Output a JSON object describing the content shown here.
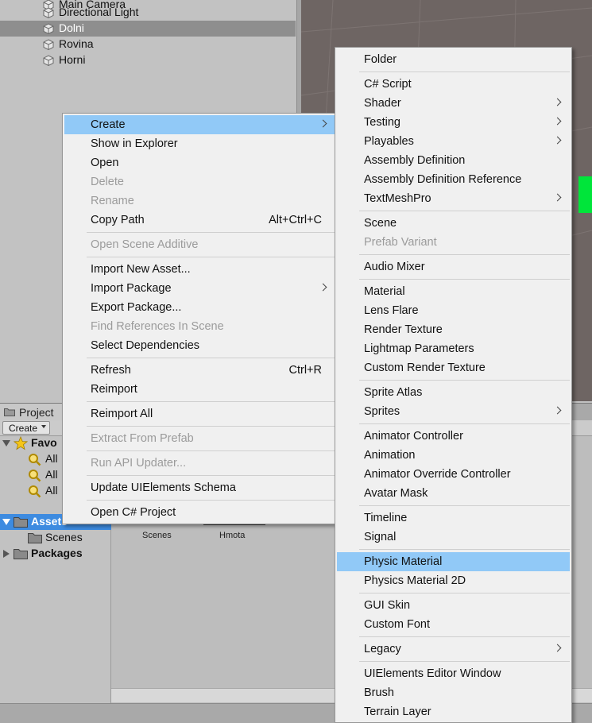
{
  "hierarchy": {
    "items": [
      {
        "label": "Main Camera",
        "selected": false
      },
      {
        "label": "Directional Light",
        "selected": false
      },
      {
        "label": "Dolni",
        "selected": true
      },
      {
        "label": "Rovina",
        "selected": false
      },
      {
        "label": "Horni",
        "selected": false
      }
    ]
  },
  "project": {
    "tab_label": "Project",
    "create_label": "Create",
    "favorites_label": "Favo",
    "favorites_items": [
      "All",
      "All",
      "All"
    ],
    "assets_label": "Assets",
    "scenes_label": "Scenes",
    "packages_label": "Packages",
    "grid_items": [
      "Scenes",
      "Hmota"
    ]
  },
  "context_menu": {
    "items": [
      {
        "label": "Create",
        "shortcut": "",
        "disabled": false,
        "highlighted": true,
        "submenu": true
      },
      {
        "label": "Show in Explorer",
        "shortcut": "",
        "disabled": false,
        "highlighted": false,
        "submenu": false
      },
      {
        "label": "Open",
        "shortcut": "",
        "disabled": false,
        "highlighted": false,
        "submenu": false
      },
      {
        "label": "Delete",
        "shortcut": "",
        "disabled": true,
        "highlighted": false,
        "submenu": false
      },
      {
        "label": "Rename",
        "shortcut": "",
        "disabled": true,
        "highlighted": false,
        "submenu": false
      },
      {
        "label": "Copy Path",
        "shortcut": "Alt+Ctrl+C",
        "disabled": false,
        "highlighted": false,
        "submenu": false
      },
      {
        "separator": true
      },
      {
        "label": "Open Scene Additive",
        "shortcut": "",
        "disabled": true,
        "highlighted": false,
        "submenu": false
      },
      {
        "separator": true
      },
      {
        "label": "Import New Asset...",
        "shortcut": "",
        "disabled": false,
        "highlighted": false,
        "submenu": false
      },
      {
        "label": "Import Package",
        "shortcut": "",
        "disabled": false,
        "highlighted": false,
        "submenu": true
      },
      {
        "label": "Export Package...",
        "shortcut": "",
        "disabled": false,
        "highlighted": false,
        "submenu": false
      },
      {
        "label": "Find References In Scene",
        "shortcut": "",
        "disabled": true,
        "highlighted": false,
        "submenu": false
      },
      {
        "label": "Select Dependencies",
        "shortcut": "",
        "disabled": false,
        "highlighted": false,
        "submenu": false
      },
      {
        "separator": true
      },
      {
        "label": "Refresh",
        "shortcut": "Ctrl+R",
        "disabled": false,
        "highlighted": false,
        "submenu": false
      },
      {
        "label": "Reimport",
        "shortcut": "",
        "disabled": false,
        "highlighted": false,
        "submenu": false
      },
      {
        "separator": true
      },
      {
        "label": "Reimport All",
        "shortcut": "",
        "disabled": false,
        "highlighted": false,
        "submenu": false
      },
      {
        "separator": true
      },
      {
        "label": "Extract From Prefab",
        "shortcut": "",
        "disabled": true,
        "highlighted": false,
        "submenu": false
      },
      {
        "separator": true
      },
      {
        "label": "Run API Updater...",
        "shortcut": "",
        "disabled": true,
        "highlighted": false,
        "submenu": false
      },
      {
        "separator": true
      },
      {
        "label": "Update UIElements Schema",
        "shortcut": "",
        "disabled": false,
        "highlighted": false,
        "submenu": false
      },
      {
        "separator": true
      },
      {
        "label": "Open C# Project",
        "shortcut": "",
        "disabled": false,
        "highlighted": false,
        "submenu": false
      }
    ]
  },
  "create_submenu": {
    "items": [
      {
        "label": "Folder",
        "disabled": false,
        "highlighted": false,
        "submenu": false
      },
      {
        "separator": true
      },
      {
        "label": "C# Script",
        "disabled": false,
        "highlighted": false,
        "submenu": false
      },
      {
        "label": "Shader",
        "disabled": false,
        "highlighted": false,
        "submenu": true
      },
      {
        "label": "Testing",
        "disabled": false,
        "highlighted": false,
        "submenu": true
      },
      {
        "label": "Playables",
        "disabled": false,
        "highlighted": false,
        "submenu": true
      },
      {
        "label": "Assembly Definition",
        "disabled": false,
        "highlighted": false,
        "submenu": false
      },
      {
        "label": "Assembly Definition Reference",
        "disabled": false,
        "highlighted": false,
        "submenu": false
      },
      {
        "label": "TextMeshPro",
        "disabled": false,
        "highlighted": false,
        "submenu": true
      },
      {
        "separator": true
      },
      {
        "label": "Scene",
        "disabled": false,
        "highlighted": false,
        "submenu": false
      },
      {
        "label": "Prefab Variant",
        "disabled": true,
        "highlighted": false,
        "submenu": false
      },
      {
        "separator": true
      },
      {
        "label": "Audio Mixer",
        "disabled": false,
        "highlighted": false,
        "submenu": false
      },
      {
        "separator": true
      },
      {
        "label": "Material",
        "disabled": false,
        "highlighted": false,
        "submenu": false
      },
      {
        "label": "Lens Flare",
        "disabled": false,
        "highlighted": false,
        "submenu": false
      },
      {
        "label": "Render Texture",
        "disabled": false,
        "highlighted": false,
        "submenu": false
      },
      {
        "label": "Lightmap Parameters",
        "disabled": false,
        "highlighted": false,
        "submenu": false
      },
      {
        "label": "Custom Render Texture",
        "disabled": false,
        "highlighted": false,
        "submenu": false
      },
      {
        "separator": true
      },
      {
        "label": "Sprite Atlas",
        "disabled": false,
        "highlighted": false,
        "submenu": false
      },
      {
        "label": "Sprites",
        "disabled": false,
        "highlighted": false,
        "submenu": true
      },
      {
        "separator": true
      },
      {
        "label": "Animator Controller",
        "disabled": false,
        "highlighted": false,
        "submenu": false
      },
      {
        "label": "Animation",
        "disabled": false,
        "highlighted": false,
        "submenu": false
      },
      {
        "label": "Animator Override Controller",
        "disabled": false,
        "highlighted": false,
        "submenu": false
      },
      {
        "label": "Avatar Mask",
        "disabled": false,
        "highlighted": false,
        "submenu": false
      },
      {
        "separator": true
      },
      {
        "label": "Timeline",
        "disabled": false,
        "highlighted": false,
        "submenu": false
      },
      {
        "label": "Signal",
        "disabled": false,
        "highlighted": false,
        "submenu": false
      },
      {
        "separator": true
      },
      {
        "label": "Physic Material",
        "disabled": false,
        "highlighted": true,
        "submenu": false
      },
      {
        "label": "Physics Material 2D",
        "disabled": false,
        "highlighted": false,
        "submenu": false
      },
      {
        "separator": true
      },
      {
        "label": "GUI Skin",
        "disabled": false,
        "highlighted": false,
        "submenu": false
      },
      {
        "label": "Custom Font",
        "disabled": false,
        "highlighted": false,
        "submenu": false
      },
      {
        "separator": true
      },
      {
        "label": "Legacy",
        "disabled": false,
        "highlighted": false,
        "submenu": true
      },
      {
        "separator": true
      },
      {
        "label": "UIElements Editor Window",
        "disabled": false,
        "highlighted": false,
        "submenu": false
      },
      {
        "label": "Brush",
        "disabled": false,
        "highlighted": false,
        "submenu": false
      },
      {
        "label": "Terrain Layer",
        "disabled": false,
        "highlighted": false,
        "submenu": false
      }
    ]
  },
  "colors": {
    "menu_highlight": "#91c9f7",
    "assets_selected": "#3d8be0",
    "scene_object": "#00e53a"
  },
  "icons": {
    "hierarchy_item": "cube-icon",
    "project_tab": "folder-icon",
    "favorites": "star-icon",
    "search": "search-icon",
    "folder": "folder-icon",
    "submenu": "chevron-right-icon"
  }
}
